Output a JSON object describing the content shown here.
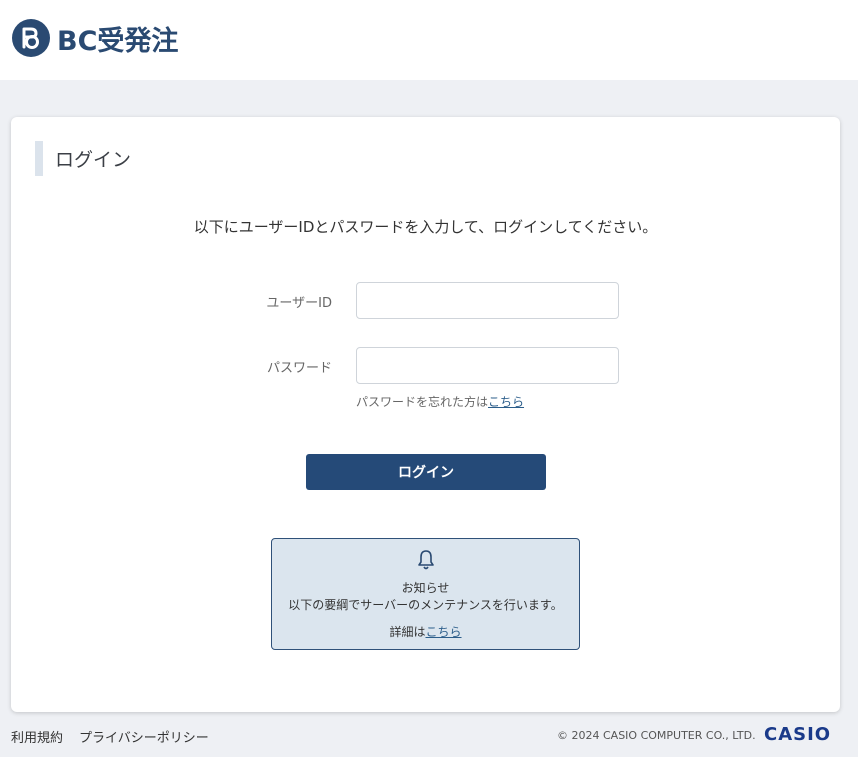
{
  "header": {
    "logo_text": "BC受発注"
  },
  "card": {
    "title": "ログイン",
    "instruction": "以下にユーザーIDとパスワードを入力して、ログインしてください。",
    "user_id": {
      "label": "ユーザーID",
      "value": "",
      "placeholder": ""
    },
    "password": {
      "label": "パスワード",
      "value": "",
      "placeholder": ""
    },
    "forgot_text": "パスワードを忘れた方は",
    "forgot_link": "こちら",
    "login_button": "ログイン"
  },
  "notice": {
    "icon": "bell-icon",
    "title": "お知らせ",
    "body": "以下の要綱でサーバーのメンテナンスを行います。",
    "details_text": "詳細は",
    "details_link": "こちら"
  },
  "footer": {
    "terms": "利用規約",
    "privacy": "プライバシーポリシー",
    "copyright": "© 2024 CASIO COMPUTER CO., LTD.",
    "brand": "CASIO"
  },
  "colors": {
    "brand": "#254a78",
    "background": "#eef0f4",
    "notice_bg": "#dbe5ee"
  }
}
